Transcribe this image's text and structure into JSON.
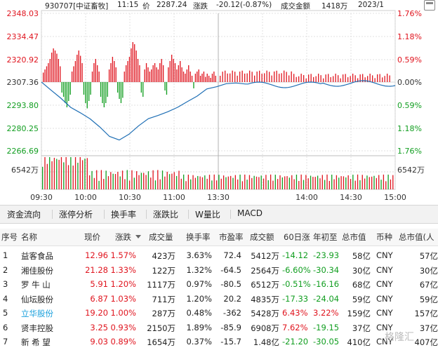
{
  "header": {
    "code_name": "930707[中证畜牧]",
    "time": "11:15",
    "price_label": "价",
    "price": "2287.24",
    "change_label": "涨跌",
    "change": "-20.12(-0.87%)",
    "amount_label": "成交金额",
    "amount": "1418万",
    "date": "2023/1"
  },
  "chart": {
    "left_axis": [
      "2348.03",
      "2334.47",
      "2320.92",
      "2307.36",
      "2293.80",
      "2280.25",
      "2266.69"
    ],
    "right_axis": [
      "1.76%",
      "1.18%",
      "0.59%",
      "0.00%",
      "0.59%",
      "1.18%",
      "1.76%"
    ],
    "volume_label_left": "6542万",
    "volume_label_right": "6542万",
    "time_labels": [
      "09:30",
      "10:00",
      "10:30",
      "11:00",
      "13:30",
      "14:00",
      "14:30",
      "15:00"
    ],
    "colors": {
      "up": "#e0141e",
      "down": "#119e20",
      "line": "#1f6fb5",
      "grid": "#d9d9d9"
    }
  },
  "chart_data": {
    "type": "line",
    "title": "",
    "xlabel": "",
    "ylabel": "",
    "x_range": [
      "09:30",
      "11:15"
    ],
    "ylim": [
      2266.69,
      2348.03
    ],
    "reference_price": 2307.36,
    "series": [
      {
        "x": [
          "09:30",
          "09:35",
          "09:40",
          "09:45",
          "09:50",
          "09:55",
          "10:00",
          "10:05",
          "10:10",
          "10:15",
          "10:20",
          "10:25",
          "10:30",
          "10:35",
          "10:40",
          "10:45",
          "10:50",
          "10:55",
          "11:00",
          "11:05",
          "11:10",
          "11:15"
        ],
        "values": [
          2307.4,
          2302.5,
          2297.8,
          2292.4,
          2289.2,
          2285.6,
          2280.8,
          2275.2,
          2273.1,
          2276.5,
          2281.5,
          2285.7,
          2287.6,
          2289.8,
          2292.4,
          2295.8,
          2299.0,
          2303.3,
          2304.6,
          2306.4,
          2306.8,
          2306.2
        ]
      }
    ],
    "volume_ratio_series": [
      [
        0.09,
        0.12,
        0.15,
        0.18,
        0.22,
        0.28,
        0.32,
        0.3,
        0.27,
        0.22,
        0.15,
        -0.1,
        -0.14,
        -0.2,
        -0.24,
        -0.18,
        -0.12
      ],
      [
        0.1,
        0.15,
        0.2,
        0.26,
        0.3,
        0.25,
        0.18,
        -0.12,
        -0.2,
        -0.25,
        -0.18,
        -0.12,
        0.1,
        0.18,
        0.22,
        0.16,
        0.1
      ],
      [
        -0.14,
        -0.2,
        -0.24,
        -0.2,
        -0.14,
        0.12,
        0.18,
        0.24,
        0.2,
        0.14,
        -0.1,
        -0.16,
        -0.2,
        -0.15,
        0.1,
        0.16,
        0.2
      ],
      [
        0.24,
        0.32,
        0.38,
        0.36,
        0.3,
        0.22,
        0.16,
        -0.1,
        -0.14,
        0.12,
        0.18,
        0.14,
        0.1,
        0.12,
        0.16,
        0.18,
        0.14
      ]
    ]
  },
  "toolbar": {
    "tabs": [
      "资金流向",
      "涨停分析",
      "换手率",
      "涨跌比",
      "W量比",
      "MACD"
    ]
  },
  "table": {
    "headers": [
      "序号",
      "名称",
      "现价",
      "涨跌",
      "成交量",
      "换手率",
      "市盈率",
      "成交额",
      "60日涨",
      "年初至",
      "总市值",
      "币种",
      "总市值(人"
    ],
    "rows": [
      {
        "no": "1",
        "name": "益客食品",
        "price": "12.96",
        "chg": "1.57%",
        "vol": "423万",
        "turnover": "3.63%",
        "pe": "72.4",
        "amount": "5412万",
        "d60": "-14.12",
        "ytd": "-23.93",
        "mcap": "58亿",
        "cur": "CNY",
        "mcap2": "57亿",
        "name_color": "dark",
        "d60_color": "green",
        "ytd_color": "green"
      },
      {
        "no": "2",
        "name": "湘佳股份",
        "price": "21.28",
        "chg": "1.33%",
        "vol": "122万",
        "turnover": "1.32%",
        "pe": "-64.5",
        "amount": "2564万",
        "d60": "-6.60%",
        "ytd": "-30.34",
        "mcap": "30亿",
        "cur": "CNY",
        "mcap2": "30亿",
        "name_color": "dark",
        "d60_color": "green",
        "ytd_color": "green"
      },
      {
        "no": "3",
        "name": "罗 牛 山",
        "price": "5.91",
        "chg": "1.20%",
        "vol": "1117万",
        "turnover": "0.97%",
        "pe": "-80.5",
        "amount": "6512万",
        "d60": "-0.51%",
        "ytd": "-16.16",
        "mcap": "68亿",
        "cur": "CNY",
        "mcap2": "67亿",
        "name_color": "dark",
        "d60_color": "green",
        "ytd_color": "green"
      },
      {
        "no": "4",
        "name": "仙坛股份",
        "price": "6.87",
        "chg": "1.03%",
        "vol": "711万",
        "turnover": "1.20%",
        "pe": "20.2",
        "amount": "4835万",
        "d60": "-17.33",
        "ytd": "-24.04",
        "mcap": "59亿",
        "cur": "CNY",
        "mcap2": "59亿",
        "name_color": "dark",
        "d60_color": "green",
        "ytd_color": "green"
      },
      {
        "no": "5",
        "name": "立华股份",
        "price": "19.20",
        "chg": "1.00%",
        "vol": "287万",
        "turnover": "0.48%",
        "pe": "-362",
        "amount": "5428万",
        "d60": "6.43%",
        "ytd": "3.22%",
        "mcap": "159亿",
        "cur": "CNY",
        "mcap2": "157亿",
        "name_color": "blue",
        "d60_color": "red",
        "ytd_color": "red"
      },
      {
        "no": "6",
        "name": "贤丰控股",
        "price": "3.25",
        "chg": "0.93%",
        "vol": "2150万",
        "turnover": "1.89%",
        "pe": "-85.9",
        "amount": "6908万",
        "d60": "7.62%",
        "ytd": "-19.15",
        "mcap": "37亿",
        "cur": "CNY",
        "mcap2": "37亿",
        "name_color": "dark",
        "d60_color": "red",
        "ytd_color": "green"
      },
      {
        "no": "7",
        "name": "新 希 望",
        "price": "9.03",
        "chg": "0.89%",
        "vol": "1654万",
        "turnover": "0.37%",
        "pe": "-15.7",
        "amount": "1.48亿",
        "d60": "-21.20",
        "ytd": "-30.05",
        "mcap": "410亿",
        "cur": "CNY",
        "mcap2": "407亿",
        "name_color": "dark",
        "d60_color": "green",
        "ytd_color": "green"
      }
    ]
  },
  "watermark": "格隆汇"
}
